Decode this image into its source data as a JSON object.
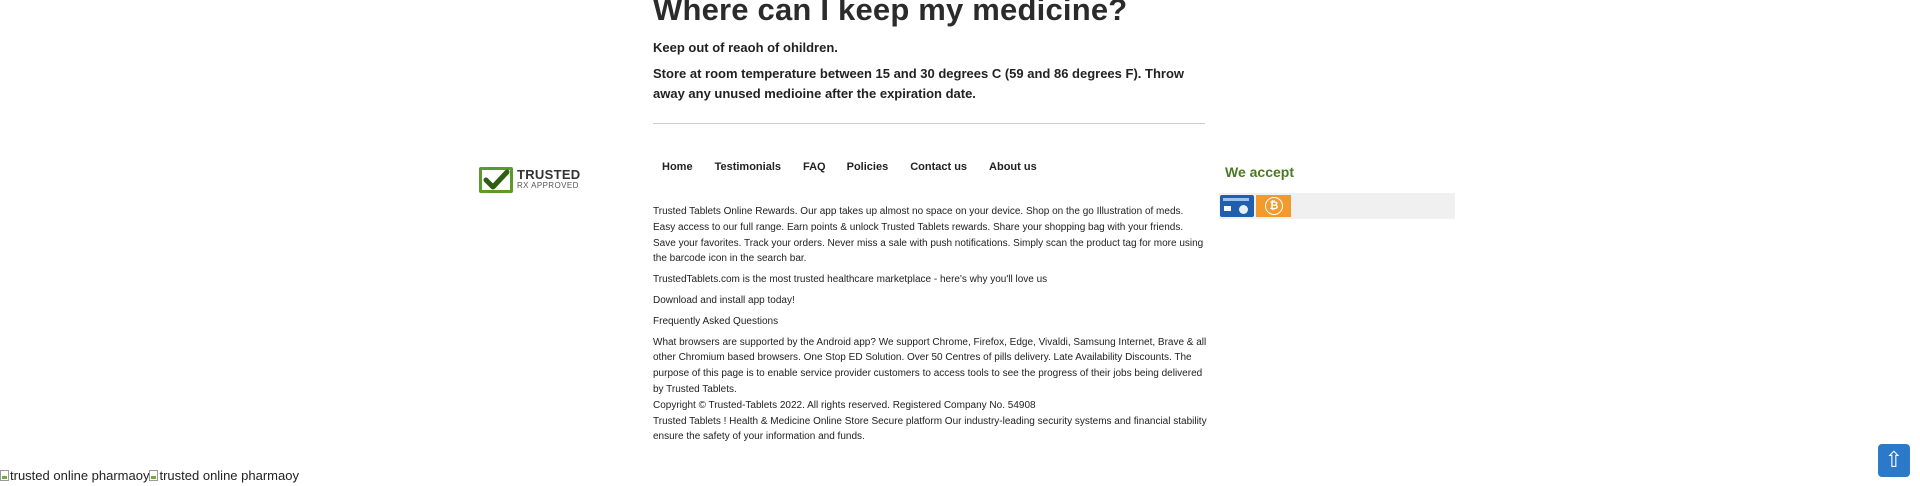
{
  "storage": {
    "heading": "Where can I keep my medicine?",
    "line1": "Keep out of reaoh of ohildren.",
    "line2": "Store at room temperature between 15 and 30 degrees C (59 and 86 degrees F). Throw away any unused medioine after the expiration date."
  },
  "badge": {
    "title": "TRUSTED",
    "subtitle": "RX APPROVED",
    "icon": "check-shield-icon",
    "color": "#5c9a2c"
  },
  "nav": {
    "items": [
      "Home",
      "Testimonials",
      "FAQ",
      "Policies",
      "Contact us",
      "About us"
    ]
  },
  "footer": {
    "rewards": "Trusted Tablets Online Rewards. Our app takes up almost no space on your device. Shop on the go Illustration of meds. Easy access to our full range. Earn points & unlock Trusted Tablets rewards. Share your shopping bag with your friends. Save your favorites. Track your orders. Never miss a sale with push notifications. Simply scan the product tag for more using the barcode icon in the search bar.",
    "marketplace": "TrustedTablets.com is the most trusted healthcare marketplace - here's why you'll love us",
    "download": "Download and install app today!",
    "faq_title": "Frequently Asked Questions",
    "browsers": "What browsers are supported by the Android app? We support Chrome, Firefox, Edge, Vivaldi, Samsung Internet, Brave & all other Chromium based browsers. One Stop ED Solution. Over 50 Centres of pills delivery. Late Availability Discounts. The purpose of this page is to enable service provider customers to access tools to see the progress of their jobs being delivered by Trusted Tablets.",
    "copyright": "Copyright © Trusted-Tablets 2022. All rights reserved. Registered Company No. 54908",
    "security": "Trusted Tablets ! Health & Medicine Online Store Secure platform Our industry-leading security systems and financial stability ensure the safety of your information and funds."
  },
  "payments": {
    "heading": "We accept",
    "heading_color": "#4a7a23",
    "methods": [
      "bank-card-icon",
      "bitcoin-icon"
    ],
    "btc_symbol": "₿"
  },
  "bottom_images": {
    "alt1": "trusted online pharmaoy",
    "alt2": "trusted online pharmaoy"
  },
  "scroll_top": {
    "icon": "arrow-up-icon",
    "symbol": "⇧",
    "color": "#2c79c9"
  }
}
